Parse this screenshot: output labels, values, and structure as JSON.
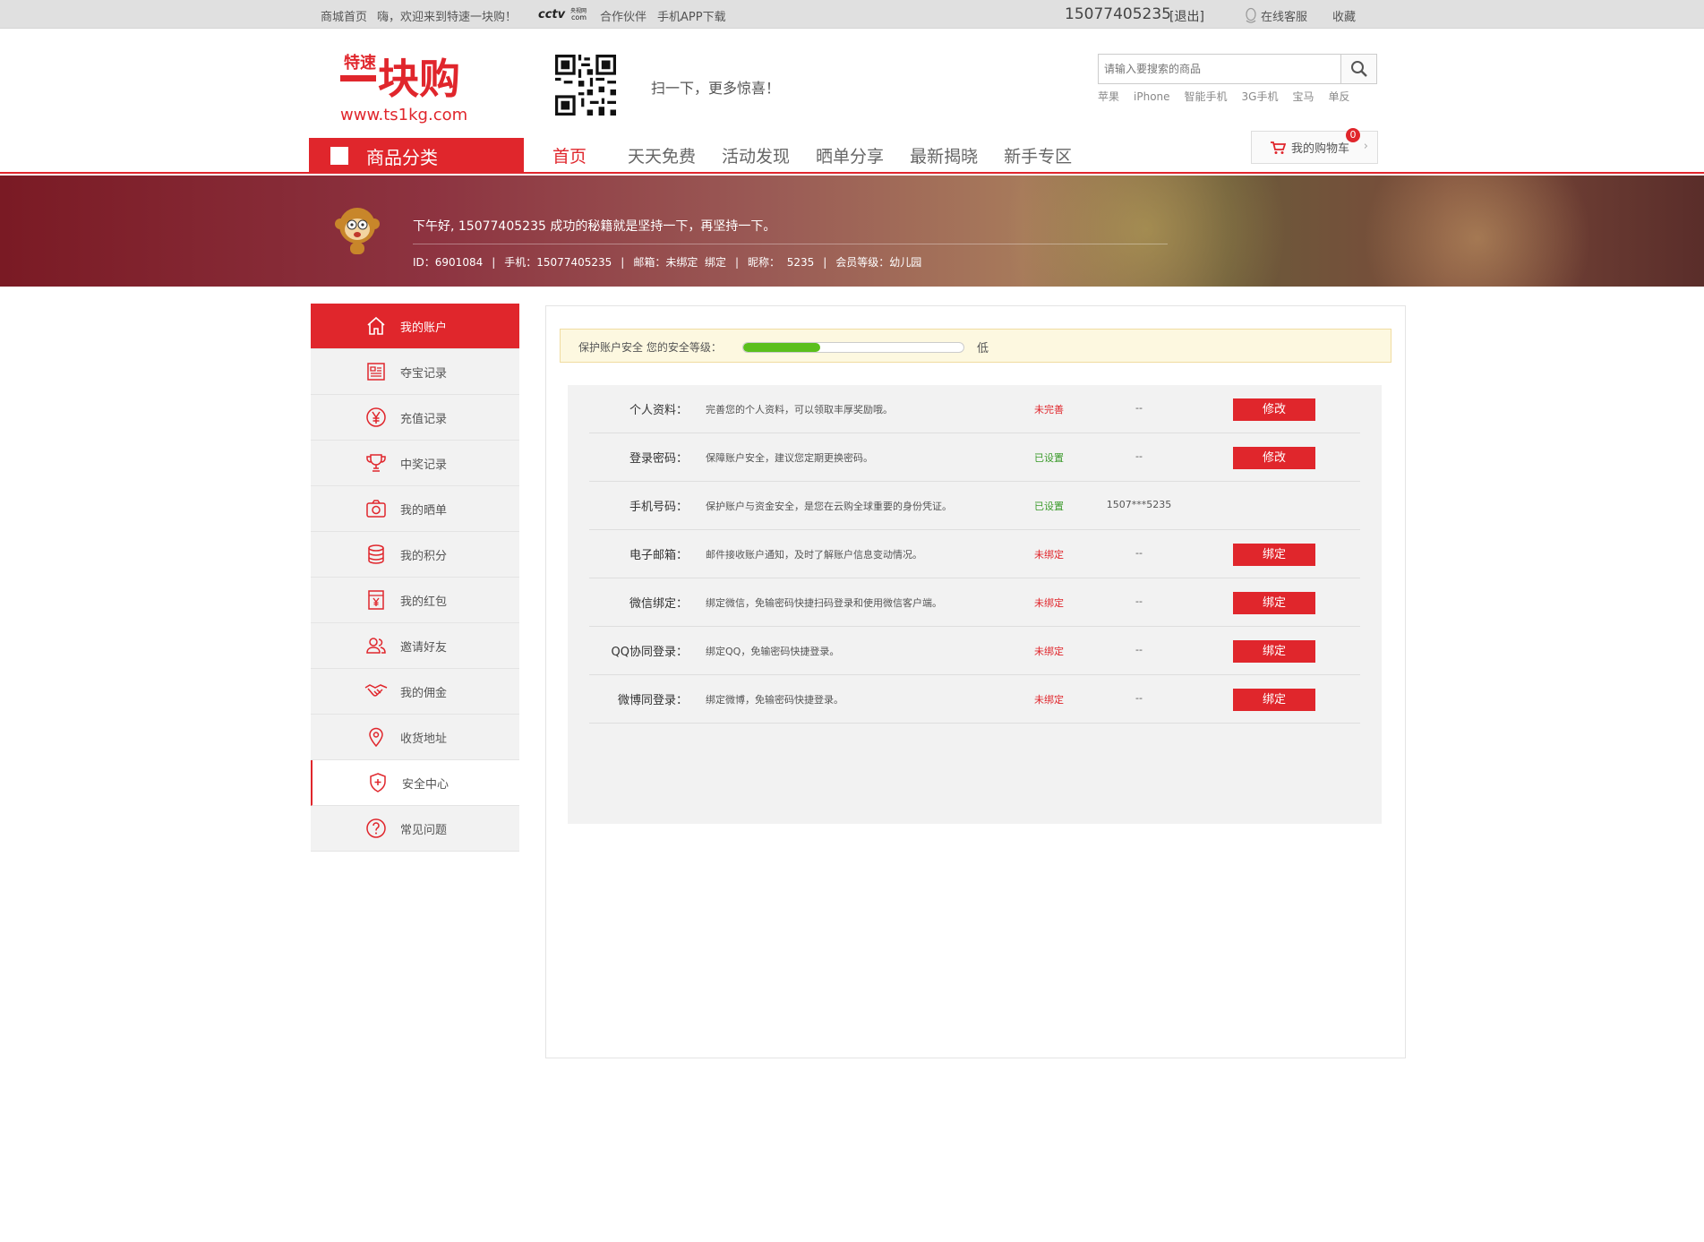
{
  "topbar": {
    "home": "商城首页",
    "welcome": "嗨，欢迎来到特速一块购！",
    "cctv_logo": "cctv.com",
    "partner": "合作伙伴",
    "app": "手机APP下载",
    "phone": "15077405235",
    "logout": "[退出]",
    "service": "在线客服",
    "favorite": "收藏"
  },
  "header": {
    "logo_top": "特速",
    "logo_main": "一块购",
    "logo_url": "www.ts1kg.com",
    "scan_text": "扫一下，更多惊喜！",
    "search_placeholder": "请输入要搜索的商品",
    "hotwords": [
      "苹果",
      "iPhone",
      "智能手机",
      "3G手机",
      "宝马",
      "单反"
    ]
  },
  "nav": {
    "category": "商品分类",
    "links": [
      "首页",
      "天天免费",
      "活动发现",
      "晒单分享",
      "最新揭晓",
      "新手专区"
    ],
    "cart_label": "我的购物车",
    "cart_count": "0"
  },
  "banner": {
    "greeting": "下午好, 15077405235 成功的秘籍就是坚持一下，再坚持一下。",
    "id": "ID：6901084",
    "mobile": "手机：15077405235",
    "email": "邮箱：未绑定",
    "email_bind": "绑定",
    "nick_label": "昵称：",
    "nick": "5235",
    "level": "会员等级：幼儿园"
  },
  "sidebar": {
    "items": [
      {
        "label": "我的账户",
        "icon": "home-icon"
      },
      {
        "label": "夺宝记录",
        "icon": "document-icon"
      },
      {
        "label": "充值记录",
        "icon": "yen-circle-icon"
      },
      {
        "label": "中奖记录",
        "icon": "trophy-icon"
      },
      {
        "label": "我的晒单",
        "icon": "camera-icon"
      },
      {
        "label": "我的积分",
        "icon": "coins-icon"
      },
      {
        "label": "我的红包",
        "icon": "red-packet-icon"
      },
      {
        "label": "邀请好友",
        "icon": "friends-icon"
      },
      {
        "label": "我的佣金",
        "icon": "handshake-icon"
      },
      {
        "label": "收货地址",
        "icon": "location-icon"
      },
      {
        "label": "安全中心",
        "icon": "shield-icon"
      },
      {
        "label": "常见问题",
        "icon": "question-icon"
      }
    ]
  },
  "security": {
    "label": "保护账户安全 您的安全等级：",
    "level": "低",
    "level_fraction": 0.35,
    "level_color": "#5bbf1c"
  },
  "rows": [
    {
      "name": "个人资料：",
      "desc": "完善您的个人资料，可以领取丰厚奖励哦。",
      "status": "未完善",
      "status_color": "#e0262c",
      "value": "--",
      "button": "修改"
    },
    {
      "name": "登录密码：",
      "desc": "保障账户安全，建议您定期更换密码。",
      "status": "已设置",
      "status_color": "#3a9a2a",
      "value": "--",
      "button": "修改"
    },
    {
      "name": "手机号码：",
      "desc": "保护账户与资金安全，是您在云购全球重要的身份凭证。",
      "status": "已设置",
      "status_color": "#3a9a2a",
      "value": "1507***5235",
      "button": ""
    },
    {
      "name": "电子邮箱：",
      "desc": "邮件接收账户通知，及时了解账户信息变动情况。",
      "status": "未绑定",
      "status_color": "#e0262c",
      "value": "--",
      "button": "绑定"
    },
    {
      "name": "微信绑定：",
      "desc": "绑定微信，免输密码快捷扫码登录和使用微信客户端。",
      "status": "未绑定",
      "status_color": "#e0262c",
      "value": "--",
      "button": "绑定"
    },
    {
      "name": "QQ协同登录：",
      "desc": "绑定QQ，免输密码快捷登录。",
      "status": "未绑定",
      "status_color": "#e0262c",
      "value": "--",
      "button": "绑定"
    },
    {
      "name": "微博同登录：",
      "desc": "绑定微博，免输密码快捷登录。",
      "status": "未绑定",
      "status_color": "#e0262c",
      "value": "--",
      "button": "绑定"
    }
  ]
}
